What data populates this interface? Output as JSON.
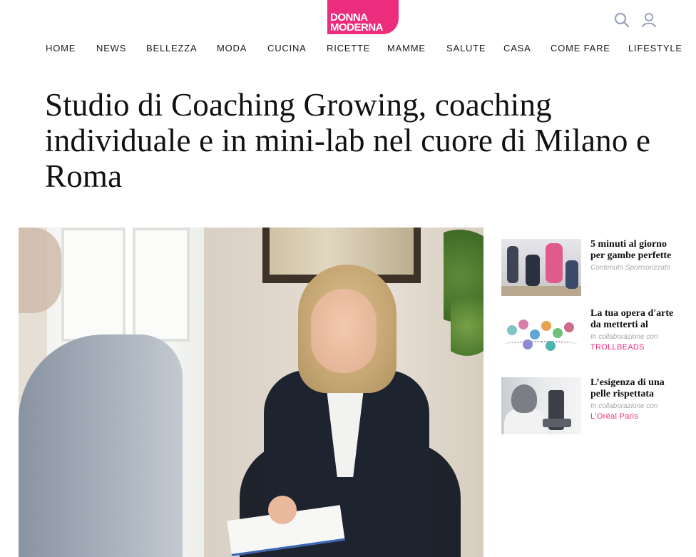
{
  "header": {
    "logo": {
      "line1": "DONNA",
      "line2": "MODERNA",
      "color": "#ec2c7c"
    },
    "icons": [
      "search-icon",
      "user-icon"
    ]
  },
  "nav": {
    "items": [
      "HOME",
      "NEWS",
      "BELLEZZA",
      "MODA",
      "CUCINA",
      "RICETTE",
      "MAMME",
      "SALUTE",
      "CASA",
      "COME FARE",
      "LIFESTYLE"
    ]
  },
  "article": {
    "title": "Studio di Coaching Growing, coaching individuale e in mini-lab nel cuore di Milano e Roma"
  },
  "sidebar": {
    "items": [
      {
        "title": "5 minuti al giorno per gambe perfette",
        "note": "Contenuto Sponsorizzato",
        "brand": ""
      },
      {
        "title": "La tua opera d'arte da metterti al",
        "note": "In collaborazione con",
        "brand": "TROLLBEADS"
      },
      {
        "title": "L’esigenza di una pelle rispettata",
        "note": "In collaborazione con",
        "brand": "L'Oréal Paris"
      }
    ]
  },
  "colors": {
    "accent": "#ec2c7c",
    "text": "#111111",
    "muted": "#a7a7a7"
  }
}
